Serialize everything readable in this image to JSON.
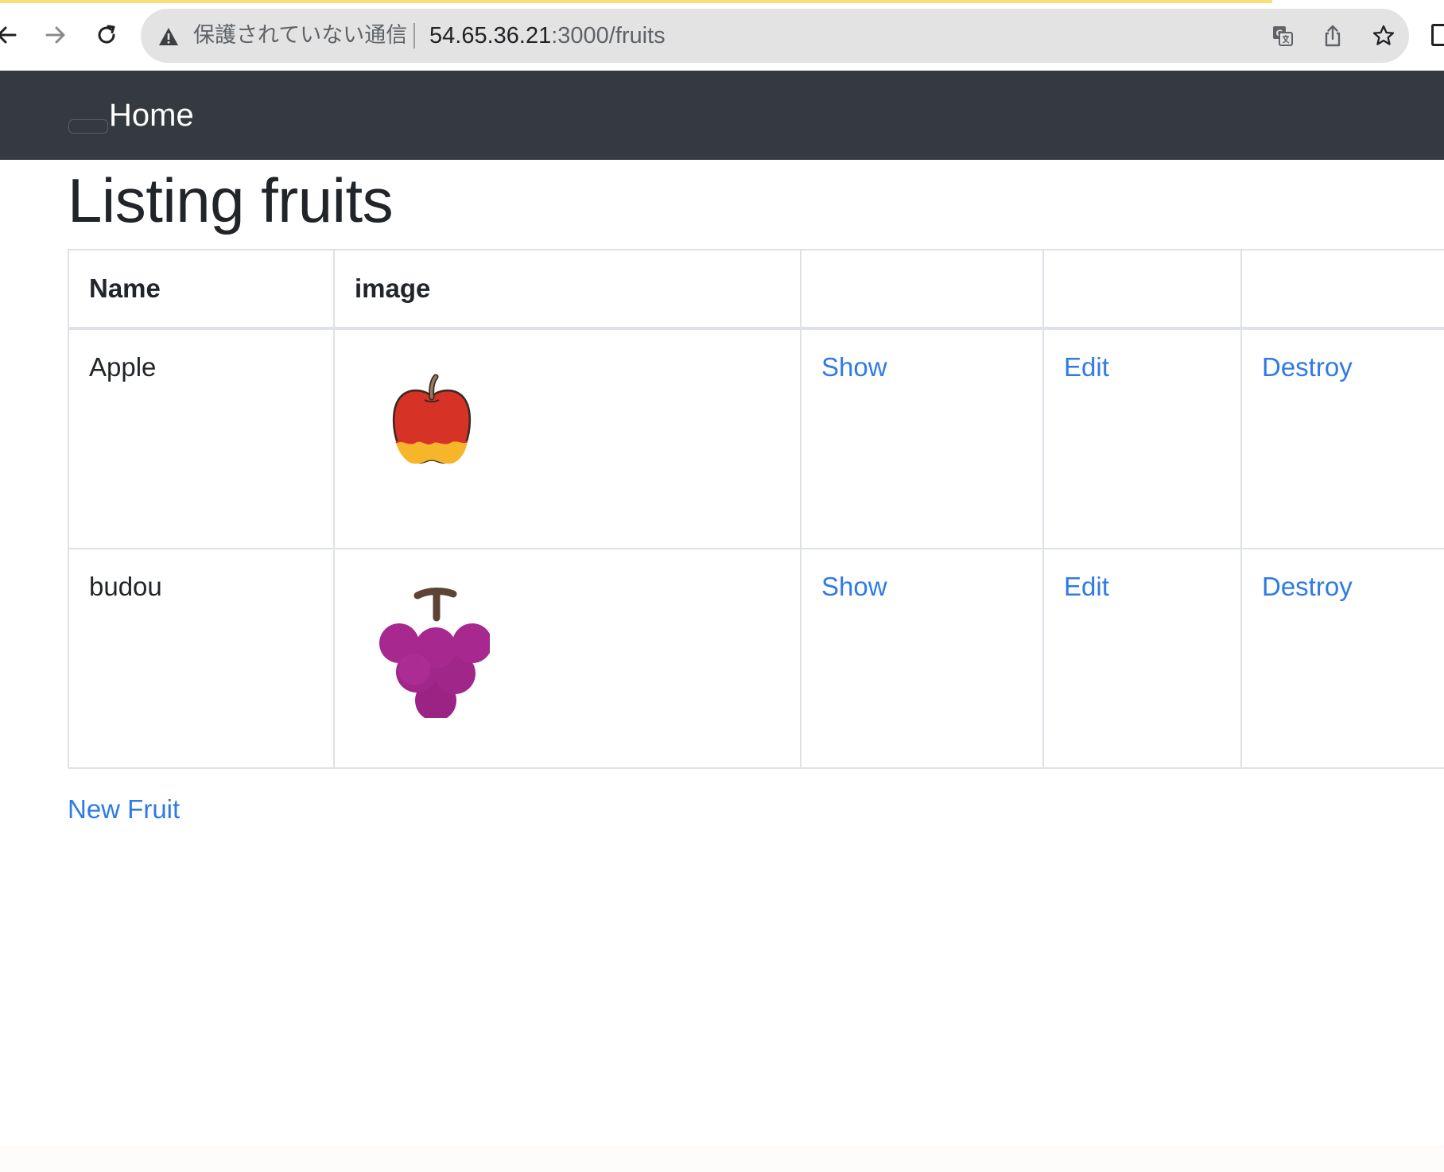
{
  "browser": {
    "security_label": "保護されていない通信",
    "url_host": "54.65.36.21",
    "url_path": ":3000/fruits",
    "icons": [
      "back-arrow-icon",
      "forward-arrow-icon",
      "reload-icon",
      "warning-icon",
      "translate-icon",
      "share-icon",
      "bookmark-star-icon"
    ]
  },
  "navbar": {
    "brand": "Home"
  },
  "page": {
    "title": "Listing fruits"
  },
  "table": {
    "headers": [
      "Name",
      "image",
      "",
      "",
      ""
    ],
    "rows": [
      {
        "name": "Apple",
        "image_icon": "apple-icon",
        "show": "Show",
        "edit": "Edit",
        "destroy": "Destroy"
      },
      {
        "name": "budou",
        "image_icon": "grapes-icon",
        "show": "Show",
        "edit": "Edit",
        "destroy": "Destroy"
      }
    ]
  },
  "actions": {
    "new_label": "New Fruit"
  },
  "colors": {
    "navbar_bg": "#343a40",
    "link": "#2f7ae5",
    "loading_bar": "#fbe07a"
  }
}
